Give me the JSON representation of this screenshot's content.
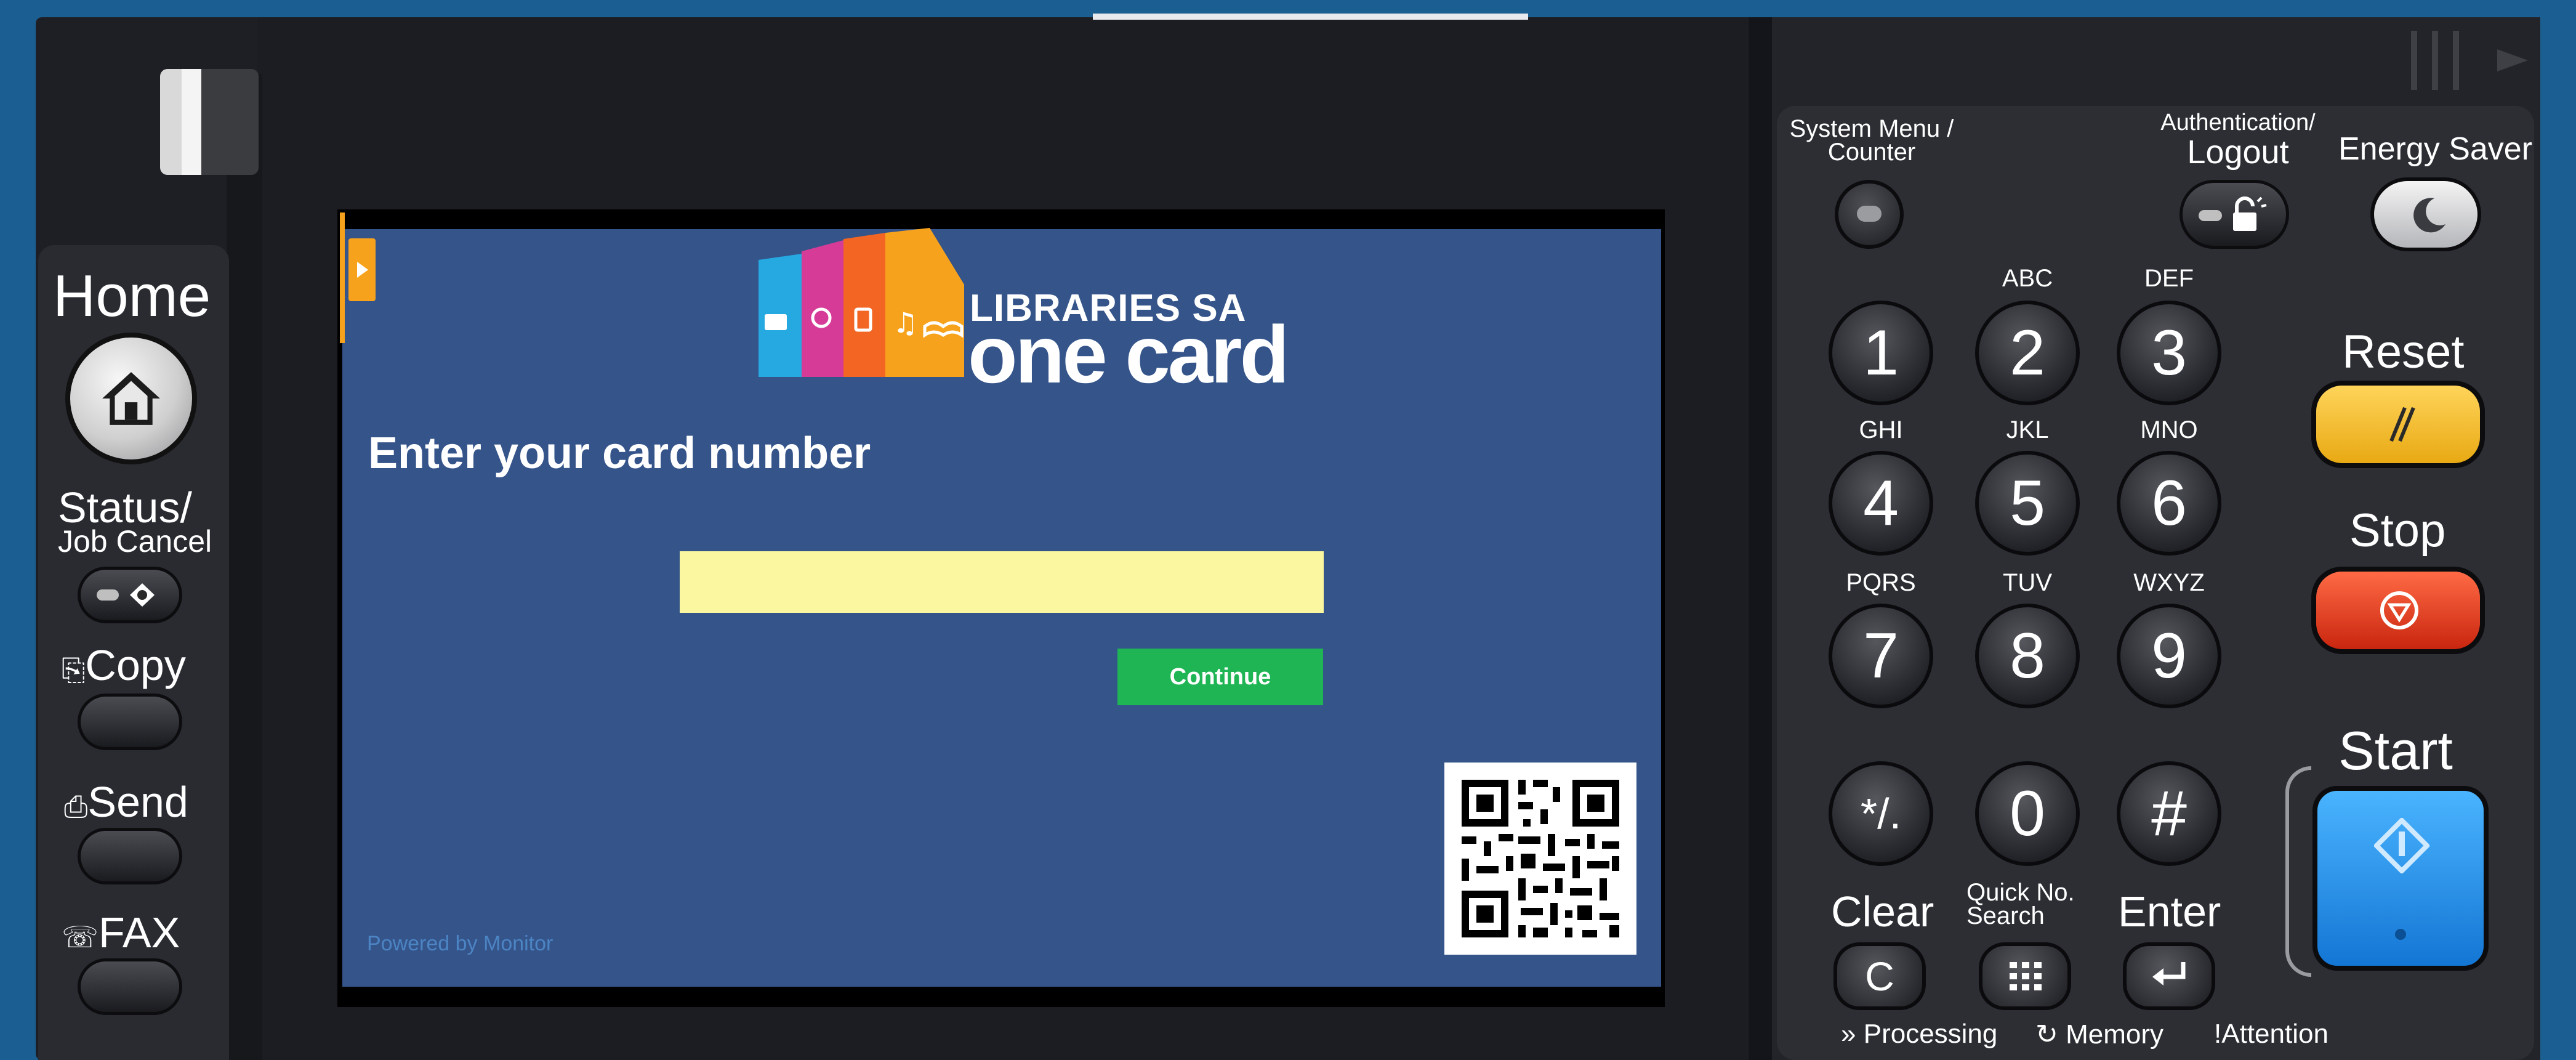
{
  "screen": {
    "logo_line1": "LIBRARIES SA",
    "logo_line2": "one card",
    "prompt": "Enter your card number",
    "card_input_value": "",
    "continue_label": "Continue",
    "powered_by": "Powered by Monitor"
  },
  "left_panel": {
    "home": "Home",
    "status_line1": "Status/",
    "status_line2": "Job Cancel",
    "copy": "Copy",
    "send": "Send",
    "fax": "FAX"
  },
  "right_panel": {
    "system_menu_line1": "System Menu /",
    "system_menu_line2": "Counter",
    "auth_line1": "Authentication/",
    "auth_line2": "Logout",
    "energy_saver": "Energy Saver",
    "reset": "Reset",
    "stop": "Stop",
    "start": "Start",
    "clear": "Clear",
    "quick_line1": "Quick No.",
    "quick_line2": "Search",
    "enter": "Enter",
    "processing": "Processing",
    "memory": "Memory",
    "attention": "Attention",
    "keys": {
      "k1": "1",
      "k2": "2",
      "k3": "3",
      "k4": "4",
      "k5": "5",
      "k6": "6",
      "k7": "7",
      "k8": "8",
      "k9": "9",
      "kstar": "*/.",
      "k0": "0",
      "khash": "#",
      "l2": "ABC",
      "l3": "DEF",
      "l4": "GHI",
      "l5": "JKL",
      "l6": "MNO",
      "l7": "PQRS",
      "l8": "TUV",
      "l9": "WXYZ",
      "clear_key": "C"
    }
  },
  "colors": {
    "screen_bg": "#34548a",
    "input_bg": "#fbf7a1",
    "continue_bg": "#1fb554",
    "reset_yellow": "#f0b41c",
    "stop_red": "#e3361f",
    "start_blue": "#1e8fe6"
  }
}
